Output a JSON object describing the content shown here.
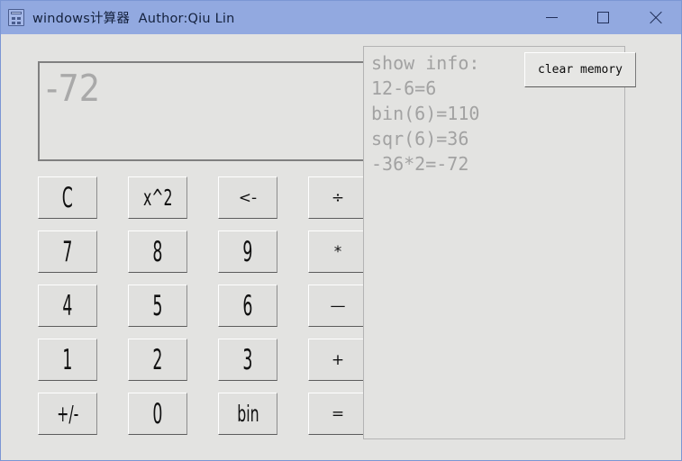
{
  "window": {
    "title": "windows计算器  Author:Qiu Lin",
    "icon": "calculator-icon",
    "titlebar_color": "#92a9e0",
    "body_color": "#e3e3e1",
    "controls": {
      "minimize": "minimize-icon",
      "maximize": "maximize-icon",
      "close": "close-icon"
    }
  },
  "display": {
    "value": "-72",
    "text_color": "#a9a9a9"
  },
  "keypad": {
    "rows": [
      [
        {
          "label": "C",
          "name": "key-clear",
          "style": "digit"
        },
        {
          "label": "x^2",
          "name": "key-square",
          "style": "small"
        },
        {
          "label": "<-",
          "name": "key-backspace",
          "style": "op"
        },
        {
          "label": "÷",
          "name": "key-divide",
          "style": "op"
        }
      ],
      [
        {
          "label": "7",
          "name": "key-7",
          "style": "digit"
        },
        {
          "label": "8",
          "name": "key-8",
          "style": "digit"
        },
        {
          "label": "9",
          "name": "key-9",
          "style": "digit"
        },
        {
          "label": "*",
          "name": "key-multiply",
          "style": "op"
        }
      ],
      [
        {
          "label": "4",
          "name": "key-4",
          "style": "digit"
        },
        {
          "label": "5",
          "name": "key-5",
          "style": "digit"
        },
        {
          "label": "6",
          "name": "key-6",
          "style": "digit"
        },
        {
          "label": "—",
          "name": "key-minus",
          "style": "op"
        }
      ],
      [
        {
          "label": "1",
          "name": "key-1",
          "style": "digit"
        },
        {
          "label": "2",
          "name": "key-2",
          "style": "digit"
        },
        {
          "label": "3",
          "name": "key-3",
          "style": "digit"
        },
        {
          "label": "+",
          "name": "key-plus",
          "style": "op"
        }
      ],
      [
        {
          "label": "+/-",
          "name": "key-sign-toggle",
          "style": "small"
        },
        {
          "label": "0",
          "name": "key-0",
          "style": "digit"
        },
        {
          "label": "bin",
          "name": "key-bin",
          "style": "small"
        },
        {
          "label": "=",
          "name": "key-equals",
          "style": "op"
        }
      ]
    ]
  },
  "info_panel": {
    "lines": [
      "show info:",
      "12-6=6",
      "bin(6)=110",
      "sqr(6)=36",
      "-36*2=-72"
    ],
    "text_color": "#a2a2a2"
  },
  "clear_memory_button": {
    "label": "clear memory"
  }
}
